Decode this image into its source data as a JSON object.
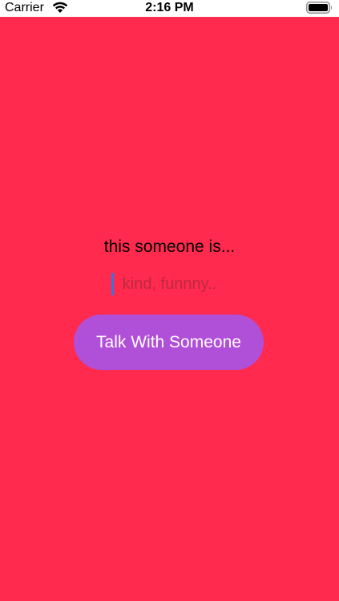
{
  "status_bar": {
    "carrier": "Carrier",
    "time": "2:16 PM",
    "wifi_icon": "wifi-icon",
    "battery_icon": "battery-full-icon"
  },
  "colors": {
    "background": "#FF2A4D",
    "button": "#B04FD8",
    "text": "#000000",
    "button_text": "#FFFFFF",
    "caret": "#3A73E0"
  },
  "main": {
    "prompt": "this someone is...",
    "input": {
      "value": "",
      "placeholder": "kind, funnny.."
    },
    "button_label": "Talk With Someone"
  }
}
